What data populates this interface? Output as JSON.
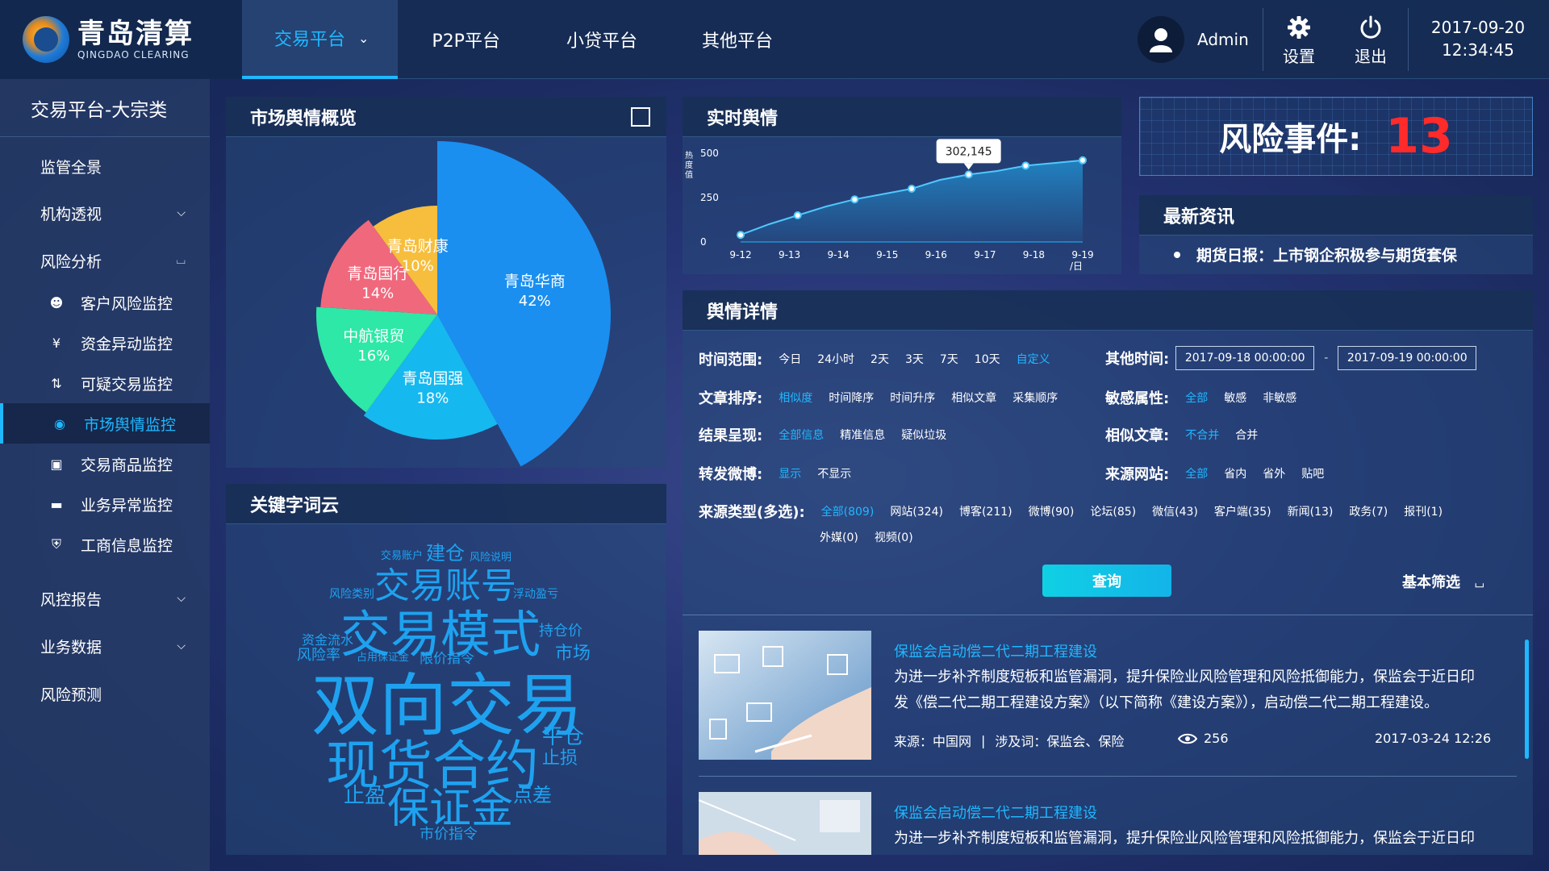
{
  "logo": {
    "cn": "青岛清算",
    "en": "QINGDAO CLEARING"
  },
  "nav": {
    "tabs": [
      "交易平台",
      "P2P平台",
      "小贷平台",
      "其他平台"
    ]
  },
  "user": {
    "name": "Admin",
    "settings": "设置",
    "logout": "退出"
  },
  "datetime": {
    "date": "2017-09-20",
    "time": "12:34:45"
  },
  "sidebar": {
    "title": "交易平台-大宗类",
    "items": [
      "监管全景",
      "机构透视",
      "风险分析",
      "风控报告",
      "业务数据",
      "风险预测"
    ],
    "sub_items": [
      "客户风险监控",
      "资金异动监控",
      "可疑交易监控",
      "市场舆情监控",
      "交易商品监控",
      "业务异常监控",
      "工商信息监控"
    ],
    "active": "市场舆情监控"
  },
  "overview": {
    "title": "市场舆情概览"
  },
  "realtime": {
    "title": "实时舆情",
    "ylabel": "热度值",
    "xunit": "/日",
    "tooltip": "302,145"
  },
  "risk": {
    "label": "风险事件:",
    "value": "13"
  },
  "news": {
    "title": "最新资讯",
    "item": "期货日报：上市钢企积极参与期货套保"
  },
  "wordcloud": {
    "title": "关键字词云"
  },
  "details": {
    "title": "舆情详情",
    "time_range": {
      "label": "时间范围:",
      "options": [
        "今日",
        "24小时",
        "2天",
        "3天",
        "7天",
        "10天",
        "自定义"
      ]
    },
    "other_time": {
      "label": "其他时间:",
      "from": "2017-09-18 00:00:00",
      "sep": "-",
      "to": "2017-09-19 00:00:00"
    },
    "sort": {
      "label": "文章排序:",
      "options": [
        "相似度",
        "时间降序",
        "时间升序",
        "相似文章",
        "采集顺序"
      ]
    },
    "sensitive": {
      "label": "敏感属性:",
      "options": [
        "全部",
        "敏感",
        "非敏感"
      ]
    },
    "result": {
      "label": "结果呈现:",
      "options": [
        "全部信息",
        "精准信息",
        "疑似垃圾"
      ]
    },
    "similar": {
      "label": "相似文章:",
      "options": [
        "不合并",
        "合并"
      ]
    },
    "weibo": {
      "label": "转发微博:",
      "options": [
        "显示",
        "不显示"
      ]
    },
    "source_site": {
      "label": "来源网站:",
      "options": [
        "全部",
        "省内",
        "省外",
        "贴吧"
      ]
    },
    "source_type": {
      "label": "来源类型(多选):",
      "options": [
        "全部(809)",
        "网站(324)",
        "博客(211)",
        "微博(90)",
        "论坛(85)",
        "微信(43)",
        "客户端(35)",
        "新闻(13)",
        "政务(7)",
        "报刊(1)"
      ],
      "options2": [
        "外媒(0)",
        "视频(0)"
      ]
    },
    "search_label": "查询",
    "basic_filter": "基本筛选"
  },
  "articles": [
    {
      "title": "保监会启动偿二代二期工程建设",
      "body1": "为进一步补齐制度短板和监管漏洞，提升保险业风险管理和风险抵御能力，保监会于近日印",
      "body2": "发《偿二代二期工程建设方案》（以下简称《建设方案》），启动偿二代二期工程建设。",
      "source": "来源：中国网",
      "keywords": "涉及词：保监会、保险",
      "views": "256",
      "date": "2017-03-24 12:26"
    },
    {
      "title": "保监会启动偿二代二期工程建设",
      "body1": "为进一步补齐制度短板和监管漏洞，提升保险业风险管理和风险抵御能力，保监会于近日印"
    }
  ],
  "colors": {
    "accent": "#1fb8ff",
    "risk": "#ff2a2a"
  },
  "chart_data": [
    {
      "type": "pie",
      "labels": [
        "青岛华商",
        "青岛国强",
        "中航银贸",
        "青岛国行",
        "青岛财康"
      ],
      "values": [
        42,
        18,
        16,
        14,
        10
      ],
      "value_labels": [
        "42%",
        "18%",
        "16%",
        "14%",
        "10%"
      ],
      "colors": [
        "#1a8ff0",
        "#16b8f0",
        "#2de8a6",
        "#f0687c",
        "#f6be3c"
      ]
    },
    {
      "type": "area",
      "categories": [
        "9-12",
        "9-13",
        "9-14",
        "9-15",
        "9-16",
        "9-17",
        "9-18",
        "9-19"
      ],
      "values": [
        40,
        100,
        150,
        200,
        240,
        270,
        300,
        350,
        380,
        400,
        430,
        445,
        460
      ],
      "yticks": [
        0,
        250,
        500
      ],
      "ylim": [
        0,
        500
      ]
    }
  ]
}
